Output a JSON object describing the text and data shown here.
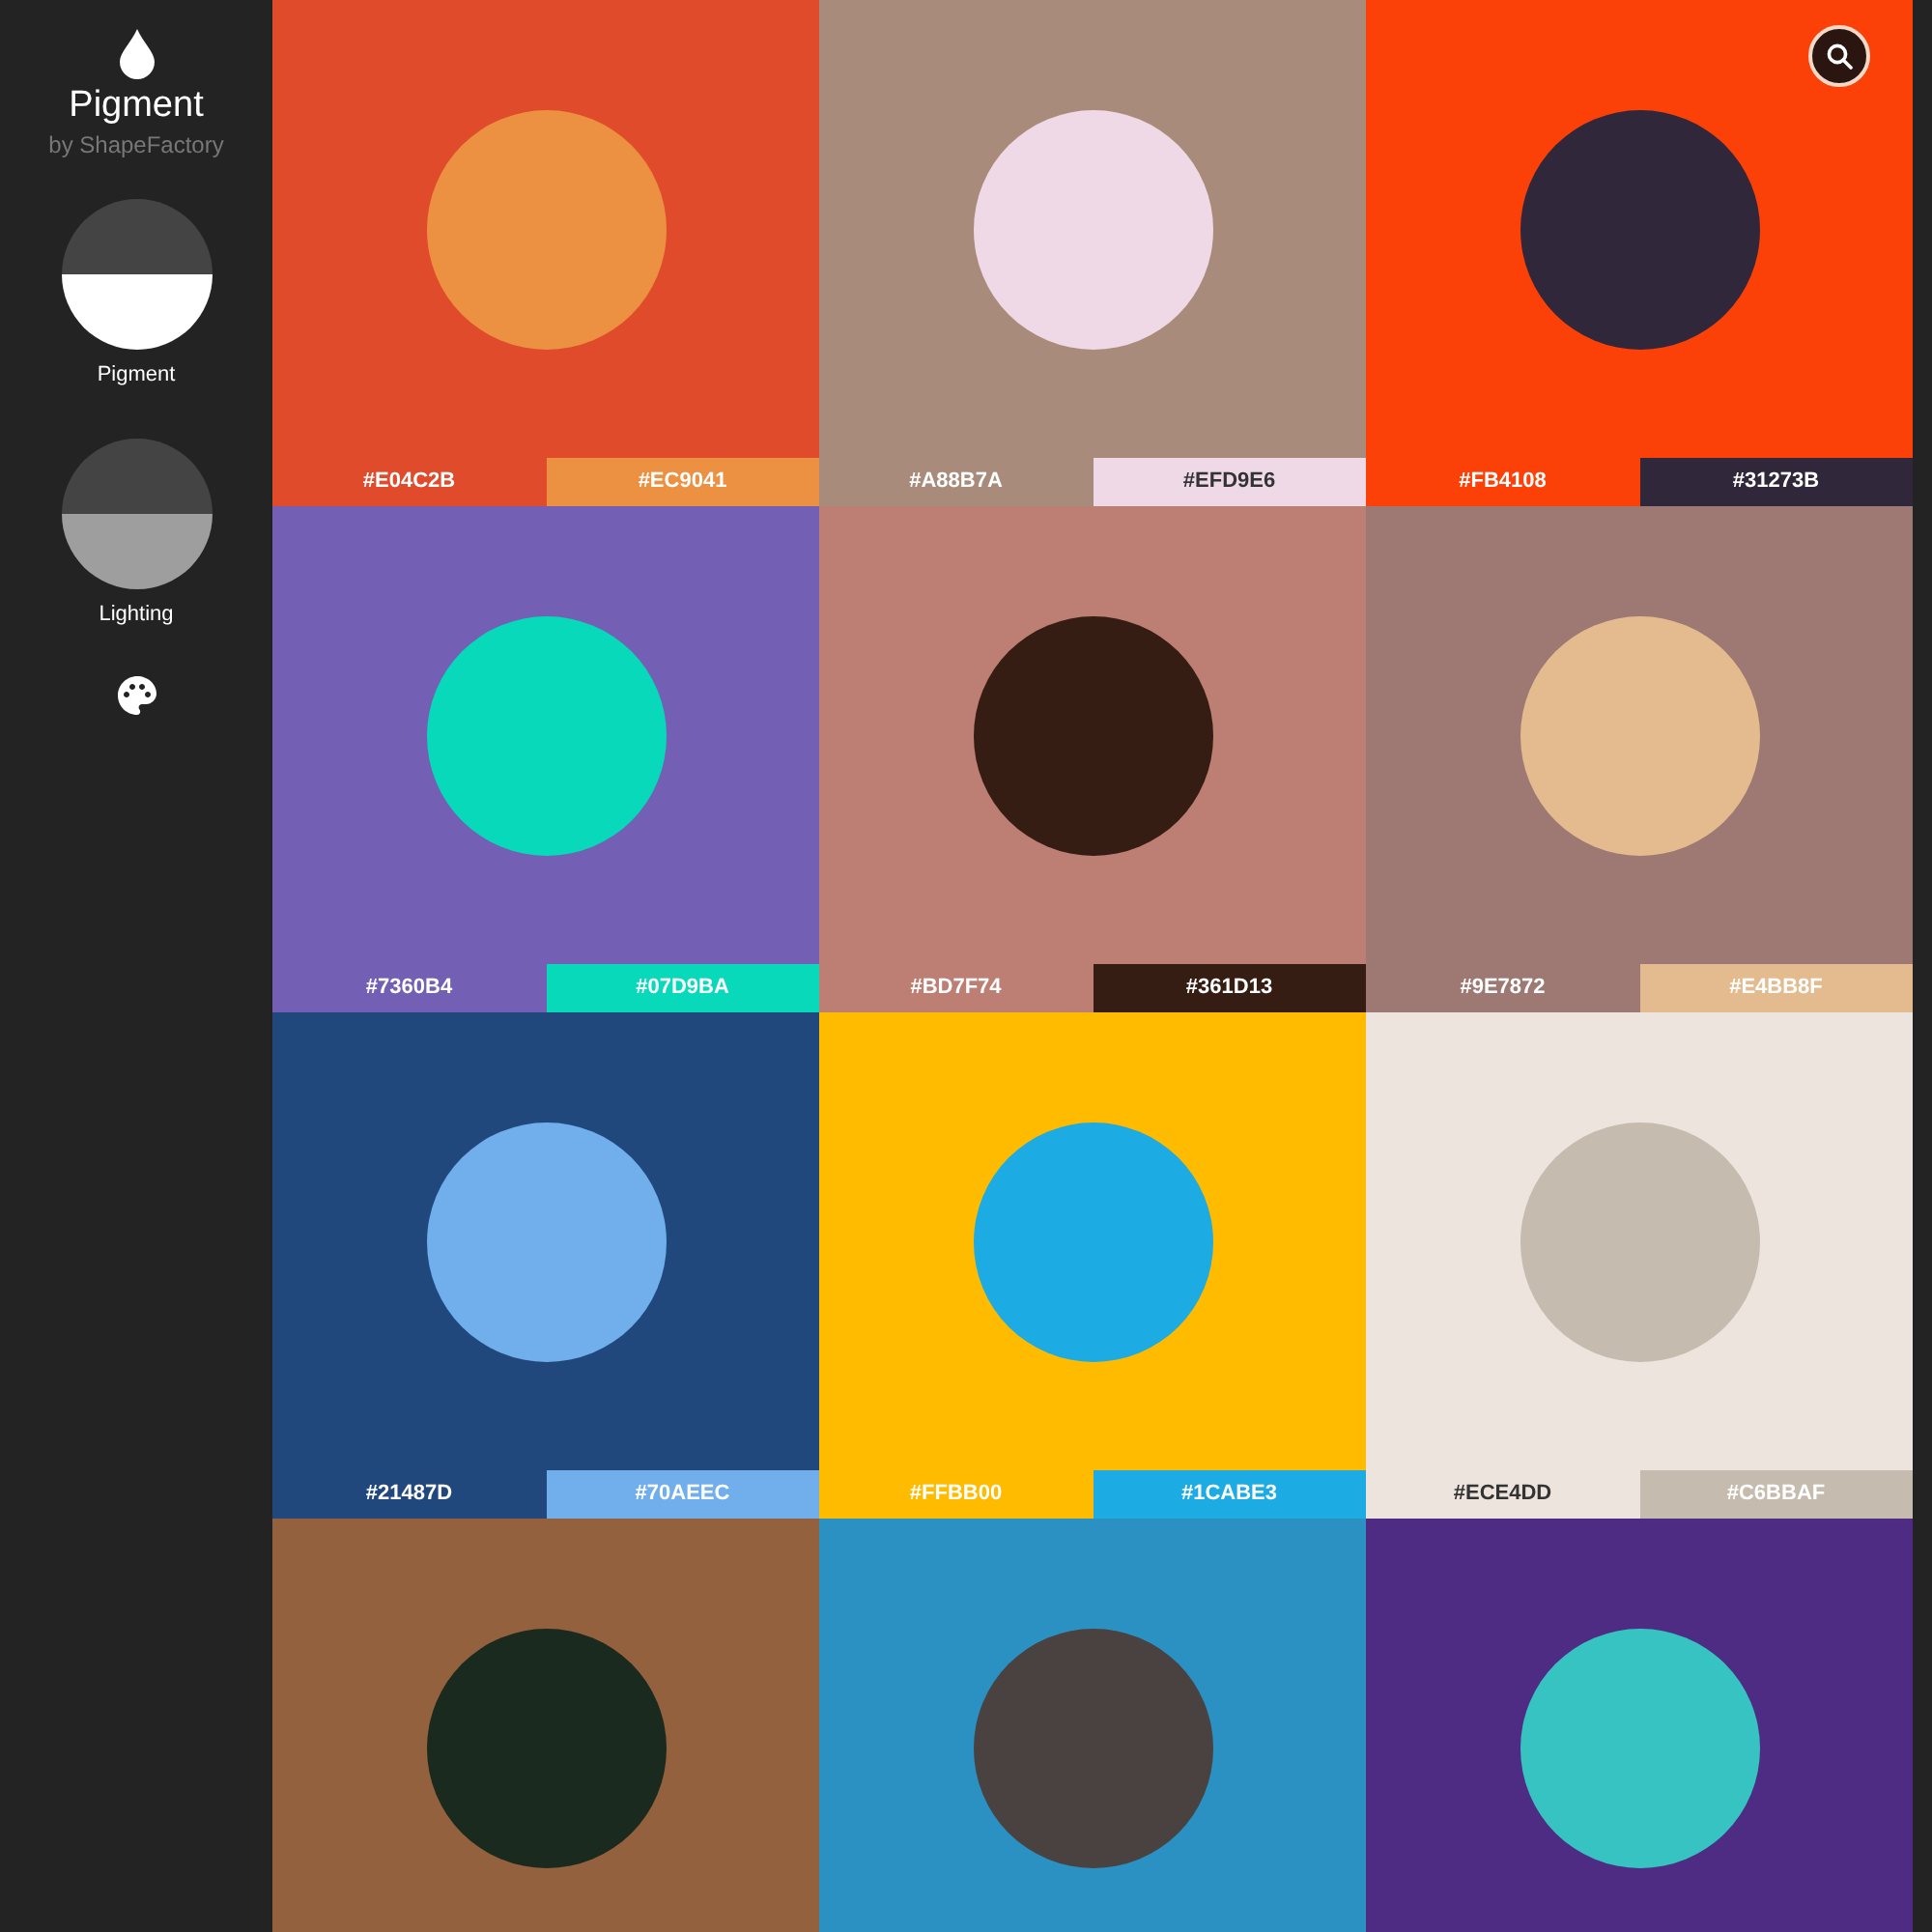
{
  "app": {
    "title": "Pigment",
    "subtitle": "by ShapeFactory"
  },
  "modes": [
    {
      "label": "Pigment",
      "selected": true
    },
    {
      "label": "Lighting",
      "selected": false
    }
  ],
  "palettes": [
    {
      "background": {
        "hex": "#E04C2B",
        "color": "#e04c2b"
      },
      "accent": {
        "hex": "#EC9041",
        "color": "#ec9041"
      }
    },
    {
      "background": {
        "hex": "#A88B7A",
        "color": "#a88b7a"
      },
      "accent": {
        "hex": "#EFD9E6",
        "color": "#efd9e6"
      }
    },
    {
      "background": {
        "hex": "#FB4108",
        "color": "#fb4108"
      },
      "accent": {
        "hex": "#31273B",
        "color": "#31273b"
      }
    },
    {
      "background": {
        "hex": "#7360B4",
        "color": "#7360b4"
      },
      "accent": {
        "hex": "#07D9BA",
        "color": "#07d9ba"
      }
    },
    {
      "background": {
        "hex": "#BD7F74",
        "color": "#bd7f74"
      },
      "accent": {
        "hex": "#361D13",
        "color": "#361d13"
      }
    },
    {
      "background": {
        "hex": "#9E7872",
        "color": "#9e7872"
      },
      "accent": {
        "hex": "#E4BB8F",
        "color": "#e4bb8f"
      }
    },
    {
      "background": {
        "hex": "#21487D",
        "color": "#21487d"
      },
      "accent": {
        "hex": "#70AEEC",
        "color": "#70aeec"
      }
    },
    {
      "background": {
        "hex": "#FFBB00",
        "color": "#ffbb00"
      },
      "accent": {
        "hex": "#1CABE3",
        "color": "#1cabe3"
      }
    },
    {
      "background": {
        "hex": "#ECE4DD",
        "color": "#ece4dd"
      },
      "accent": {
        "hex": "#C6BBAF",
        "color": "#c6bbaf"
      }
    },
    {
      "background": {
        "color": "#93613d"
      },
      "accent": {
        "color": "#1b2a1e"
      }
    },
    {
      "background": {
        "color": "#2a91c2"
      },
      "accent": {
        "color": "#4a4240"
      }
    },
    {
      "background": {
        "color": "#4e2c84"
      },
      "accent": {
        "color": "#38c3c3"
      }
    }
  ]
}
